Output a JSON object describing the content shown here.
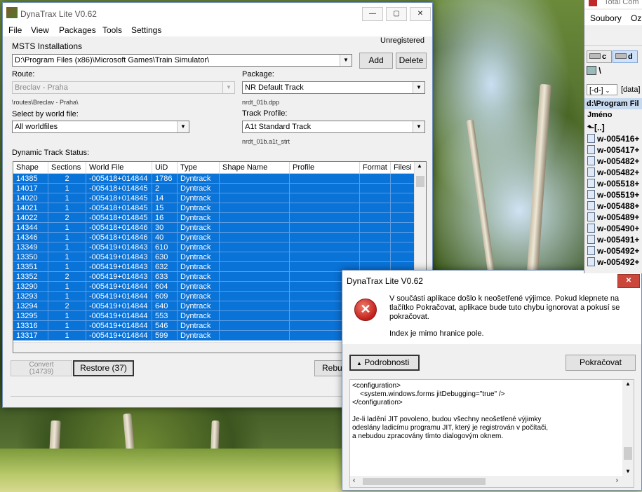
{
  "main_window": {
    "title": "DynaTrax Lite V0.62",
    "controls": {
      "minimize": "—",
      "maximize": "▢",
      "close": "✕"
    },
    "menu": [
      "File",
      "View",
      "Packages",
      "Tools",
      "Settings"
    ],
    "registration_status": "Unregistered",
    "msts_label": "MSTS Installations",
    "msts_path": "D:\\Program Files (x86)\\Microsoft Games\\Train Simulator\\",
    "add_button": "Add",
    "delete_button": "Delete",
    "route_label": "Route:",
    "route_value": "Breclav - Praha",
    "route_path": "\\routes\\Breclav - Praha\\",
    "package_label": "Package:",
    "package_value": "NR Default Track",
    "package_file": "nrdt_01b.dpp",
    "world_label": "Select by world file:",
    "world_value": "All worldfiles",
    "profile_label": "Track Profile:",
    "profile_value": "A1t Standard Track",
    "profile_file": "nrdt_01b.a1t_strt",
    "status_label": "Dynamic Track Status:",
    "columns": [
      "Shape",
      "Sections",
      "World File",
      "UiD",
      "Type",
      "Shape Name",
      "Profile",
      "Format",
      "Filesi"
    ],
    "rows": [
      [
        "14385",
        "2",
        "-005418+014844",
        "1786",
        "Dyntrack"
      ],
      [
        "14017",
        "1",
        "-005418+014845",
        "2",
        "Dyntrack"
      ],
      [
        "14020",
        "1",
        "-005418+014845",
        "14",
        "Dyntrack"
      ],
      [
        "14021",
        "1",
        "-005418+014845",
        "15",
        "Dyntrack"
      ],
      [
        "14022",
        "2",
        "-005418+014845",
        "16",
        "Dyntrack"
      ],
      [
        "14344",
        "1",
        "-005418+014846",
        "30",
        "Dyntrack"
      ],
      [
        "14346",
        "1",
        "-005418+014846",
        "40",
        "Dyntrack"
      ],
      [
        "13349",
        "1",
        "-005419+014843",
        "610",
        "Dyntrack"
      ],
      [
        "13350",
        "1",
        "-005419+014843",
        "630",
        "Dyntrack"
      ],
      [
        "13351",
        "1",
        "-005419+014843",
        "632",
        "Dyntrack"
      ],
      [
        "13352",
        "2",
        "-005419+014843",
        "633",
        "Dyntrack"
      ],
      [
        "13290",
        "1",
        "-005419+014844",
        "604",
        "Dyntrack"
      ],
      [
        "13293",
        "1",
        "-005419+014844",
        "609",
        "Dyntrack"
      ],
      [
        "13294",
        "2",
        "-005419+014844",
        "640",
        "Dyntrack"
      ],
      [
        "13295",
        "1",
        "-005419+014844",
        "553",
        "Dyntrack"
      ],
      [
        "13316",
        "1",
        "-005419+014844",
        "546",
        "Dyntrack"
      ],
      [
        "13317",
        "1",
        "-005419+014844",
        "599",
        "Dyntrack"
      ]
    ],
    "convert_button": "Convert",
    "convert_count": "(14739)",
    "restore_button": "Restore (37)",
    "rebuild_button": "Rebui"
  },
  "error_dialog": {
    "title": "DynaTrax Lite V0.62",
    "message_1": "V součásti aplikace došlo k neošetřené výjimce. Pokud klepnete na tlačítko Pokračovat, aplikace bude tuto chybu ignorovat a pokusí se pokračovat.",
    "message_2": "Index je mimo hranice pole.",
    "details_button": "Podrobnosti",
    "continue_button": "Pokračovat",
    "details_lines": [
      "<configuration>",
      "    <system.windows.forms jitDebugging=\"true\" />",
      "</configuration>",
      "",
      "Je-li ladění JIT povoleno, budou všechny neošetřené výjimky",
      "odeslány ladicímu programu JIT, který je registrován v počítači,",
      "a nebudou zpracovány tímto dialogovým oknem."
    ]
  },
  "file_manager": {
    "title": "Total Com",
    "menu": [
      "Soubory",
      "Ozn"
    ],
    "drives": [
      "c",
      "d"
    ],
    "root": "\\",
    "drive_selector": "[-d-]",
    "data_label": "[data]",
    "path": "d:\\Program Fil",
    "column_name": "Jméno",
    "up_dir": "[..]",
    "files": [
      "w-005416+",
      "w-005417+",
      "w-005482+",
      "w-005482+",
      "w-005518+",
      "w-005519+",
      "w-005488+",
      "w-005489+",
      "w-005490+",
      "w-005491+",
      "w-005492+",
      "w-005492+"
    ]
  },
  "colors": {
    "selection": "#0a73d8",
    "error_red": "#c1201a",
    "window_border": "#6d8bb5"
  }
}
